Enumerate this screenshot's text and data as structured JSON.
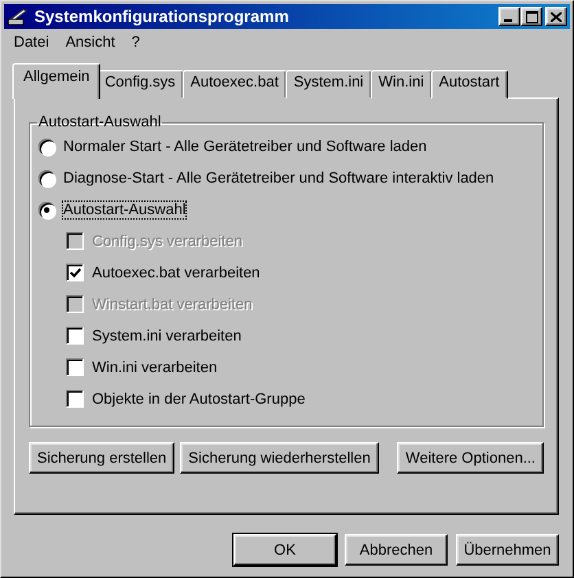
{
  "window": {
    "title": "Systemkonfigurationsprogramm"
  },
  "menu": [
    "Datei",
    "Ansicht",
    "?"
  ],
  "tabs": [
    {
      "label": "Allgemein",
      "selected": true
    },
    {
      "label": "Config.sys",
      "selected": false
    },
    {
      "label": "Autoexec.bat",
      "selected": false
    },
    {
      "label": "System.ini",
      "selected": false
    },
    {
      "label": "Win.ini",
      "selected": false
    },
    {
      "label": "Autostart",
      "selected": false
    }
  ],
  "group": {
    "title": "Autostart-Auswahl",
    "modes": [
      {
        "label": "Normaler Start - Alle Gerätetreiber und Software laden",
        "selected": false
      },
      {
        "label": "Diagnose-Start - Alle Gerätetreiber und Software interaktiv laden",
        "selected": false
      },
      {
        "label": "Autostart-Auswahl",
        "selected": true
      }
    ],
    "options": [
      {
        "label": "Config.sys verarbeiten",
        "checked": false,
        "disabled": true
      },
      {
        "label": "Autoexec.bat verarbeiten",
        "checked": true,
        "disabled": false
      },
      {
        "label": "Winstart.bat verarbeiten",
        "checked": false,
        "disabled": true
      },
      {
        "label": "System.ini verarbeiten",
        "checked": false,
        "disabled": false
      },
      {
        "label": "Win.ini verarbeiten",
        "checked": false,
        "disabled": false
      },
      {
        "label": "Objekte in der Autostart-Gruppe",
        "checked": false,
        "disabled": false
      }
    ]
  },
  "panel_buttons": [
    "Sicherung erstellen",
    "Sicherung wiederherstellen",
    "Weitere Optionen..."
  ],
  "dialog_buttons": [
    {
      "label": "OK",
      "default": true
    },
    {
      "label": "Abbrechen",
      "default": false
    },
    {
      "label": "Übernehmen",
      "default": false
    }
  ]
}
